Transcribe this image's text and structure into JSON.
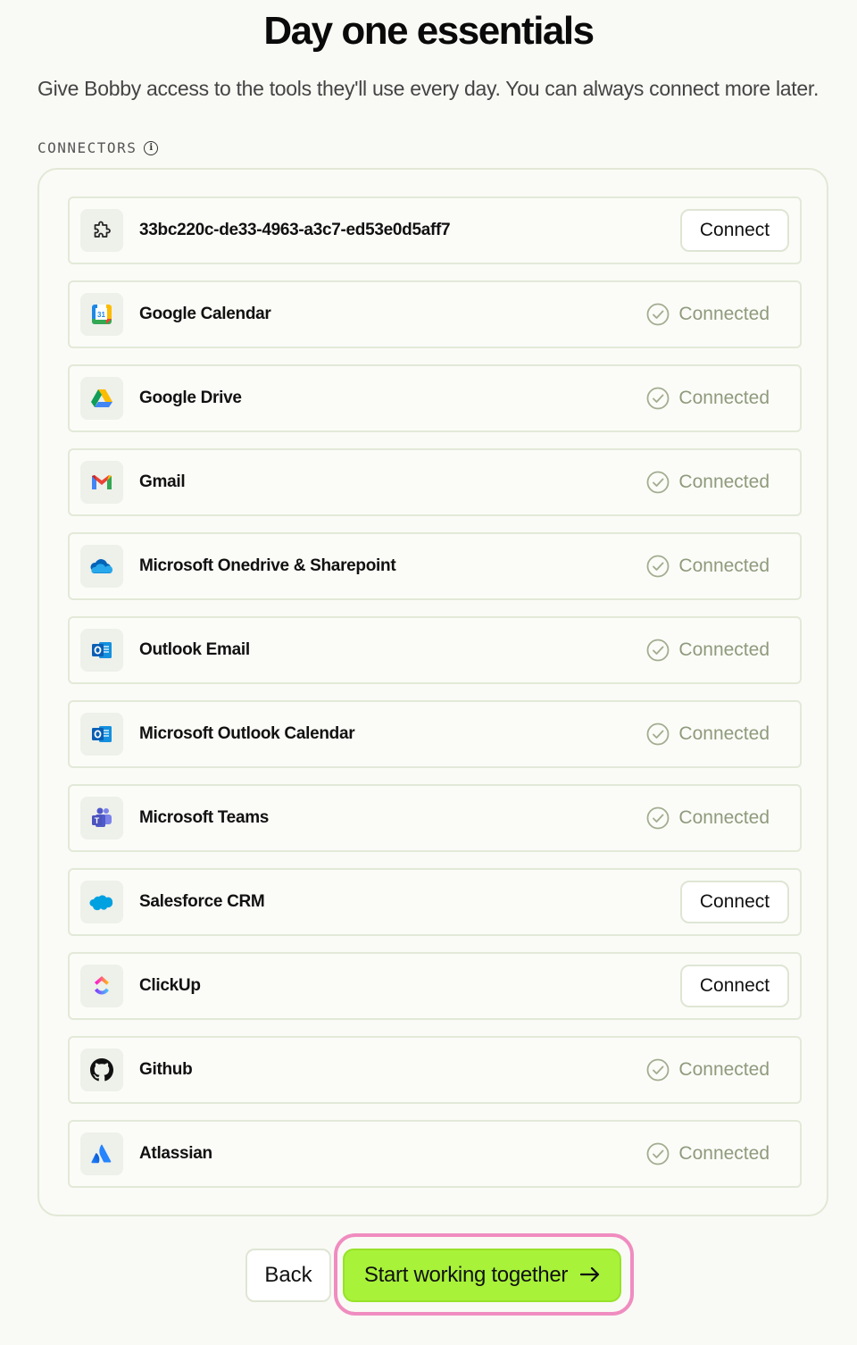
{
  "header": {
    "title": "Day one essentials",
    "subtitle": "Give Bobby access to the tools they'll use every day. You can always connect more later."
  },
  "section": {
    "label": "CONNECTORS",
    "info_icon": "info-icon"
  },
  "connectors": [
    {
      "name": "33bc220c-de33-4963-a3c7-ed53e0d5aff7",
      "icon": "puzzle-icon",
      "status": "connect",
      "action_label": "Connect"
    },
    {
      "name": "Google Calendar",
      "icon": "google-calendar-icon",
      "status": "connected",
      "status_label": "Connected"
    },
    {
      "name": "Google Drive",
      "icon": "google-drive-icon",
      "status": "connected",
      "status_label": "Connected"
    },
    {
      "name": "Gmail",
      "icon": "gmail-icon",
      "status": "connected",
      "status_label": "Connected"
    },
    {
      "name": "Microsoft Onedrive & Sharepoint",
      "icon": "onedrive-icon",
      "status": "connected",
      "status_label": "Connected"
    },
    {
      "name": "Outlook Email",
      "icon": "outlook-icon",
      "status": "connected",
      "status_label": "Connected"
    },
    {
      "name": "Microsoft Outlook Calendar",
      "icon": "outlook-icon",
      "status": "connected",
      "status_label": "Connected"
    },
    {
      "name": "Microsoft Teams",
      "icon": "teams-icon",
      "status": "connected",
      "status_label": "Connected"
    },
    {
      "name": "Salesforce CRM",
      "icon": "salesforce-icon",
      "status": "connect",
      "action_label": "Connect"
    },
    {
      "name": "ClickUp",
      "icon": "clickup-icon",
      "status": "connect",
      "action_label": "Connect"
    },
    {
      "name": "Github",
      "icon": "github-icon",
      "status": "connected",
      "status_label": "Connected"
    },
    {
      "name": "Atlassian",
      "icon": "atlassian-icon",
      "status": "connected",
      "status_label": "Connected"
    }
  ],
  "footer": {
    "back_label": "Back",
    "start_label": "Start working together",
    "start_icon": "arrow-right-icon"
  },
  "colors": {
    "primary_button": "#a8f23a",
    "focus_ring": "#f08cc0",
    "connected_text": "#8f9a7c",
    "background": "#f9faf5"
  }
}
